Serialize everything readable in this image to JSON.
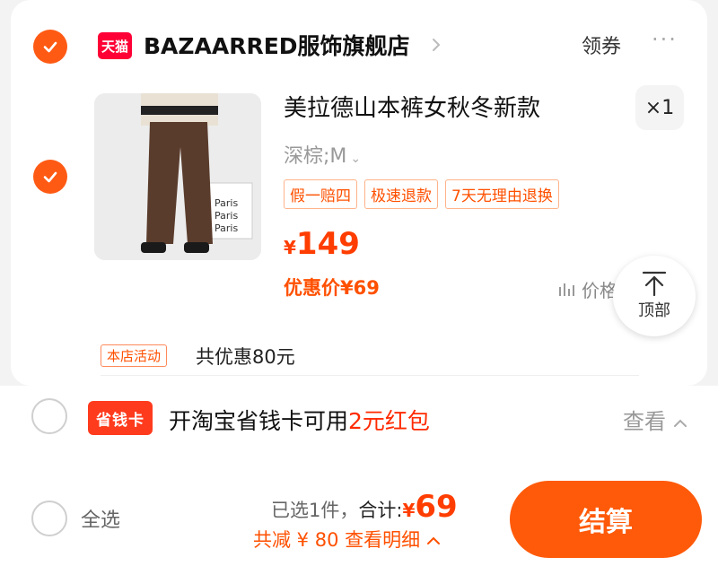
{
  "shop": {
    "platform_badge": "天猫",
    "name": "BAZAARRED服饰旗舰店",
    "coupon_label": "领券",
    "more_label": "···"
  },
  "item": {
    "title": "美拉德山本裤女秋冬新款",
    "quantity": "×1",
    "sku": "深棕;M",
    "tags": [
      "假一赔四",
      "极速退款",
      "7天无理由退换"
    ],
    "price_currency": "¥",
    "price": "149",
    "promo_price": "优惠价¥69",
    "trend_label": "价格",
    "image_text": [
      "Paris",
      "Paris",
      "Paris"
    ]
  },
  "activity": {
    "tag": "本店活动",
    "text": "共优惠80元"
  },
  "to_top": {
    "label": "顶部"
  },
  "savings_card": {
    "logo": "省钱卡",
    "text_prefix": "开淘宝省钱卡可用",
    "text_highlight": "2元红包",
    "view_label": "查看"
  },
  "checkout": {
    "select_all_label": "全选",
    "selected_label": "已选1件，",
    "total_label": "合计:",
    "total_currency": "¥",
    "total_amount": "69",
    "reduction_label": "共减 ¥ 80  查看明细",
    "pay_button": "结算"
  },
  "colors": {
    "accent": "#ff5a14",
    "price_red": "#ff3d00",
    "tmall_red": "#ff0036"
  }
}
